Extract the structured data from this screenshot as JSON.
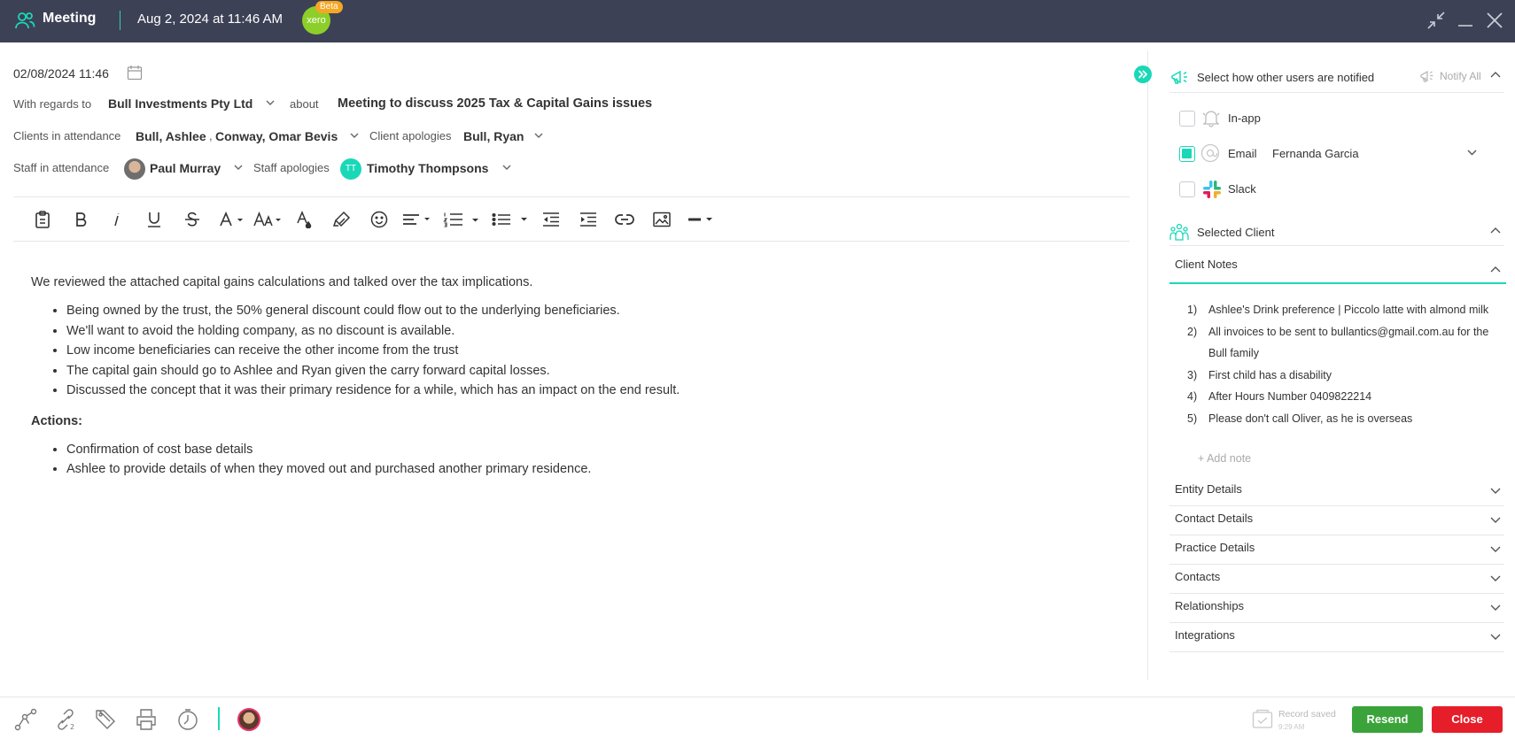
{
  "window": {
    "title": "Meeting",
    "datetime": "Aug 2, 2024 at 11:46 AM",
    "xero_label": "xero",
    "beta_label": "Beta"
  },
  "meeting": {
    "date": "02/08/2024 11:46",
    "regards_label": "With regards to",
    "regards_value": "Bull Investments Pty Ltd",
    "about_label": "about",
    "about_value": "Meeting to discuss 2025 Tax & Capital Gains issues",
    "clients_label": "Clients in attendance",
    "clients_value_1": "Bull, Ashlee",
    "clients_sep": ",",
    "clients_value_2": "Conway, Omar Bevis",
    "apologies_label": "Client apologies",
    "apologies_value": "Bull, Ryan",
    "staff_label": "Staff in attendance",
    "staff_value": "Paul Murray",
    "staff_apologies_label": "Staff apologies",
    "staff_apologies_initials": "TT",
    "staff_apologies_value": "Timothy Thompsons"
  },
  "editor": {
    "intro": "We reviewed the attached capital gains calculations and talked over the tax implications.",
    "bullets": [
      "Being owned by the trust, the 50% general discount could flow out to the underlying beneficiaries.",
      "We'll want to avoid the holding company, as no discount is available.",
      "Low income beneficiaries can receive the other income from the trust",
      "The capital gain should go to Ashlee and Ryan given the carry forward capital losses.",
      "Discussed the concept that it was their primary residence for a while, which has an impact on the end result."
    ],
    "actions_heading": "Actions:",
    "actions": [
      "Confirmation of cost base details",
      "Ashlee to provide details of when they moved out and purchased another primary residence."
    ]
  },
  "notify": {
    "title": "Select how other users are notified",
    "notify_all": "Notify All",
    "inapp_label": "In-app",
    "inapp_checked": false,
    "email_label": "Email",
    "email_checked": true,
    "email_user": "Fernanda Garcia",
    "slack_label": "Slack",
    "slack_checked": false
  },
  "client_panel": {
    "title": "Selected Client",
    "notes_title": "Client Notes",
    "notes": [
      {
        "num": "1)",
        "text": "Ashlee's Drink preference | Piccolo latte with almond milk"
      },
      {
        "num": "2)",
        "text": "All invoices to be sent to bullantics@gmail.com.au for the Bull family"
      },
      {
        "num": "3)",
        "text": "First child has a disability"
      },
      {
        "num": "4)",
        "text": "After Hours Number 0409822214"
      },
      {
        "num": "5)",
        "text": "Please don't call Oliver, as he is overseas"
      }
    ],
    "add_note": "+ Add note",
    "sections": [
      "Entity Details",
      "Contact Details",
      "Practice Details",
      "Contacts",
      "Relationships",
      "Integrations"
    ]
  },
  "footer": {
    "record_saved": "Record saved",
    "record_time": "9:29 AM",
    "resend_label": "Resend",
    "close_label": "Close"
  },
  "colors": {
    "titlebar": "#3d4155",
    "accent": "#19d8b8",
    "resend": "#3aa43a",
    "close": "#e61e2a"
  }
}
